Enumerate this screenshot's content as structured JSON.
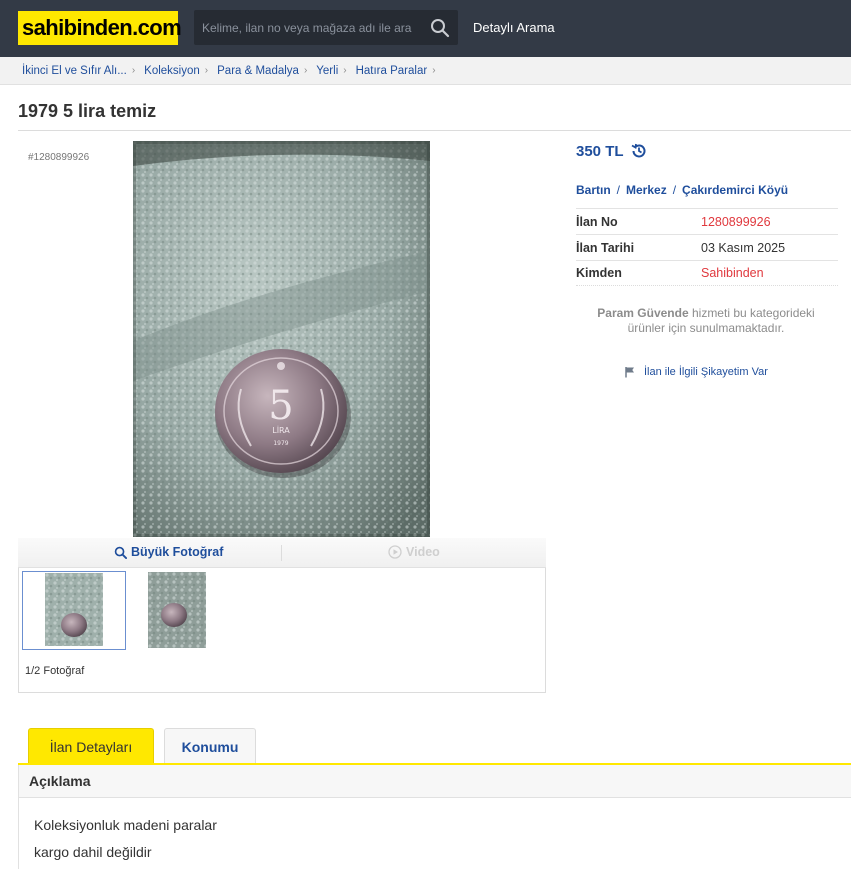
{
  "header": {
    "logo": "sahibinden.com",
    "search_placeholder": "Kelime, ilan no veya mağaza adı ile ara",
    "detailed_search": "Detaylı Arama"
  },
  "breadcrumb": [
    "İkinci El ve Sıfır Alı...",
    "Koleksiyon",
    "Para & Madalya",
    "Yerli",
    "Hatıra Paralar"
  ],
  "listing": {
    "title": "1979 5 lira temiz",
    "id_tag": "#1280899926",
    "price": "350 TL",
    "location": [
      "Bartın",
      "Merkez",
      "Çakırdemirci Köyü"
    ],
    "details": [
      {
        "label": "İlan No",
        "value": "1280899926",
        "highlight": true
      },
      {
        "label": "İlan Tarihi",
        "value": "03 Kasım 2025",
        "highlight": false
      },
      {
        "label": "Kimden",
        "value": "Sahibinden",
        "highlight": true
      }
    ],
    "safe_note_bold": "Param Güvende",
    "safe_note_rest": " hizmeti bu kategorideki ürünler için sunulmamaktadır.",
    "complaint": "İlan ile İlgili Şikayetim Var"
  },
  "gallery": {
    "big_photo": "Büyük Fotoğraf",
    "video": "Video",
    "photo_count": "1/2 Fotoğraf",
    "coin_number": "5",
    "coin_text": "LİRA",
    "coin_year": "1979"
  },
  "tabs": {
    "details": "İlan Detayları",
    "location": "Konumu"
  },
  "description": {
    "heading": "Açıklama",
    "lines": [
      "Koleksiyonluk madeni paralar",
      "kargo dahil değildir"
    ]
  },
  "colors": {
    "brand_yellow": "#ffe800",
    "header_bg": "#333a46",
    "link_blue": "#1f4e9c",
    "red": "#e0393e"
  }
}
